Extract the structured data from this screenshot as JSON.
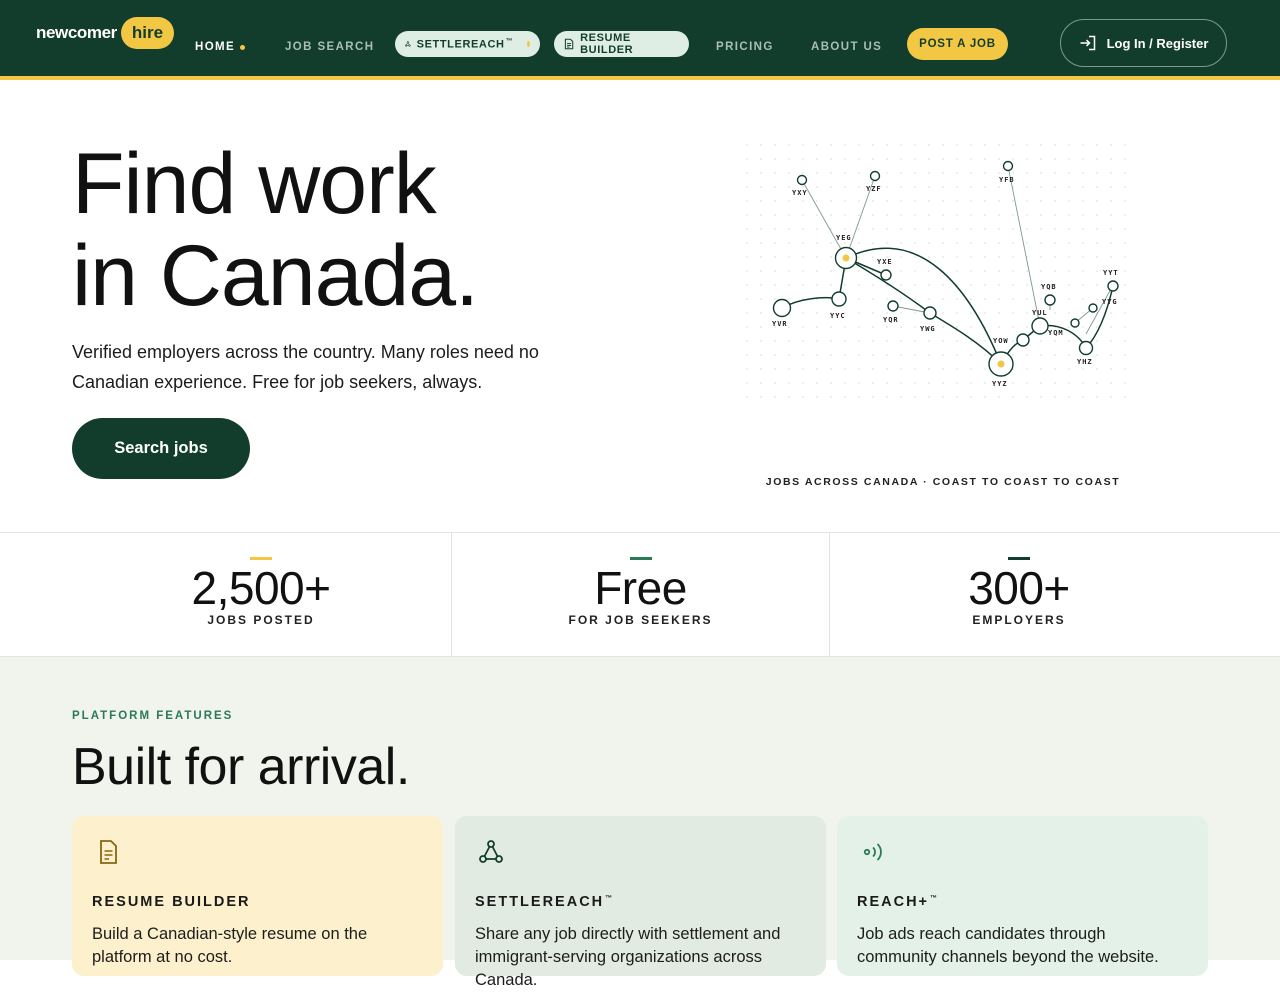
{
  "nav": {
    "logo_text": "newcomer",
    "logo_pill": "hire",
    "links": {
      "home": "HOME",
      "job_search": "JOB SEARCH",
      "pricing": "PRICING",
      "about": "ABOUT US"
    },
    "settlereach_chip": "SETTLEREACH",
    "resume_chip": "RESUME BUILDER",
    "post_job": "POST A JOB",
    "login": "Log In / Register",
    "trademark": "™"
  },
  "hero": {
    "title_line1": "Find work",
    "title_line2": "in Canada.",
    "subtitle": "Verified employers across the country. Many roles need no Canadian experience. Free for job seekers, always.",
    "search_button": "Search jobs",
    "map_caption": "JOBS ACROSS CANADA · COAST TO COAST TO COAST",
    "cities": [
      "YXY",
      "YZF",
      "YFB",
      "YEG",
      "YXE",
      "YVR",
      "YYC",
      "YQR",
      "YWG",
      "YOW",
      "YUL",
      "YQB",
      "YQM",
      "YYT",
      "YYG",
      "YHZ",
      "YYZ"
    ]
  },
  "stats": [
    {
      "value": "2,500+",
      "label": "JOBS POSTED",
      "accent": "#f2c744"
    },
    {
      "value": "Free",
      "label": "FOR JOB SEEKERS",
      "accent": "#2b7a55"
    },
    {
      "value": "300+",
      "label": "EMPLOYERS",
      "accent": "#123d2c"
    }
  ],
  "features": {
    "eyebrow": "PLATFORM FEATURES",
    "title": "Built for arrival.",
    "cards": [
      {
        "title": "RESUME BUILDER",
        "text": "Build a Canadian-style resume on the platform at no cost.",
        "icon": "document-icon",
        "bg": "#fdf0cc"
      },
      {
        "title": "SETTLEREACH",
        "text": "Share any job directly with settlement and immigrant-serving organizations across Canada.",
        "icon": "network-icon",
        "bg": "#e2ebe1"
      },
      {
        "title": "REACH+",
        "text": "Job ads reach candidates through community channels beyond the website.",
        "icon": "broadcast-icon",
        "bg": "#e3f1e8"
      }
    ]
  },
  "colors": {
    "brand_dark": "#123d2c",
    "brand_yellow": "#f2c744",
    "brand_green": "#2b7a55"
  }
}
